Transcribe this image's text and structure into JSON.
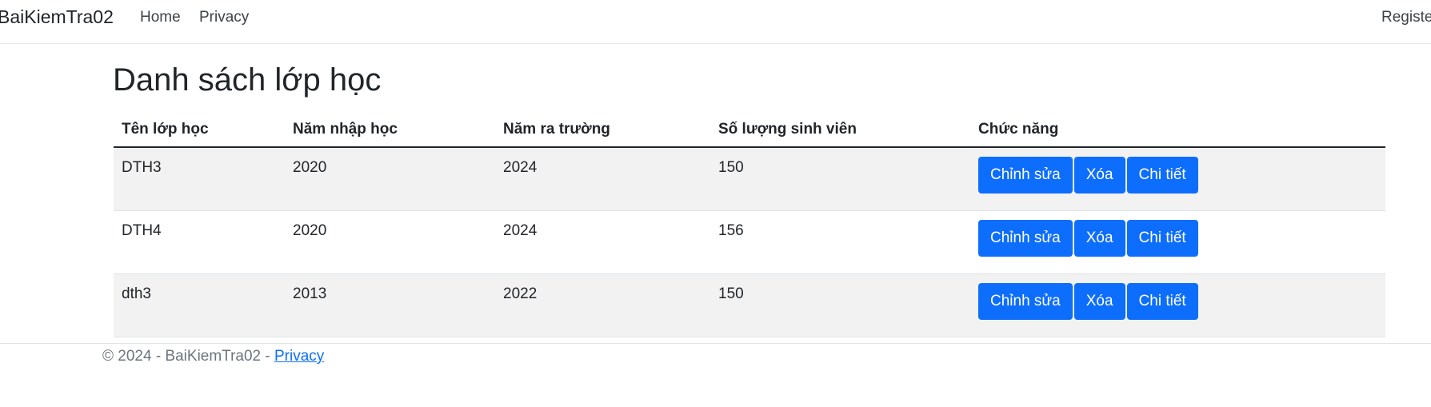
{
  "navbar": {
    "brand": "BaiKiemTra02",
    "links": [
      "Home",
      "Privacy"
    ],
    "register": "Registe"
  },
  "page": {
    "title": "Danh sách lớp học"
  },
  "table": {
    "headers": [
      "Tên lớp học",
      "Năm nhập học",
      "Năm ra trường",
      "Số lượng sinh viên",
      "Chức năng"
    ],
    "rows": [
      [
        "DTH3",
        "2020",
        "2024",
        "150"
      ],
      [
        "DTH4",
        "2020",
        "2024",
        "156"
      ],
      [
        "dth3",
        "2013",
        "2022",
        "150"
      ]
    ],
    "actions": {
      "edit": "Chỉnh sửa",
      "delete": "Xóa",
      "details": "Chi tiết"
    }
  },
  "footer": {
    "text": "© 2024 - BaiKiemTra02 - ",
    "link": "Privacy"
  },
  "colors": {
    "primary": "#0d6efd",
    "stripe": "#f2f2f2",
    "text": "#212529",
    "muted": "#6c757d"
  }
}
